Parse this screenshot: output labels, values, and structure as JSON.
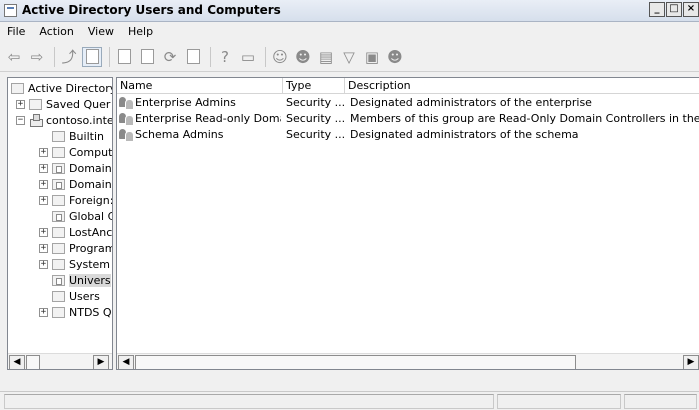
{
  "window": {
    "title": "Active Directory Users and Computers"
  },
  "window_buttons": {
    "minimize": "_",
    "maximize": "□",
    "close": "×"
  },
  "menu": [
    "File",
    "Action",
    "View",
    "Help"
  ],
  "toolbar": {
    "icons": [
      "back-icon",
      "forward-icon",
      "up-icon",
      "show-tree-icon",
      "properties-icon",
      "copy-icon",
      "refresh-icon",
      "export-icon",
      "help-icon",
      "console-icon",
      "add-user-icon",
      "add-group-icon",
      "add-ou-icon",
      "filter-icon",
      "find-icon",
      "add-to-group-icon"
    ]
  },
  "tree": {
    "root": "Active Directory",
    "items": [
      {
        "label": "Saved Quer",
        "expander": "+"
      },
      {
        "label": "contoso.inte",
        "expander": "−"
      },
      {
        "label": "Builtin",
        "expander": ""
      },
      {
        "label": "Comput",
        "expander": "+"
      },
      {
        "label": "Domain",
        "expander": "+"
      },
      {
        "label": "Domain",
        "expander": "+"
      },
      {
        "label": "Foreign:",
        "expander": "+"
      },
      {
        "label": "Global C",
        "expander": ""
      },
      {
        "label": "LostAnc",
        "expander": "+"
      },
      {
        "label": "Program",
        "expander": "+"
      },
      {
        "label": "System",
        "expander": "+"
      },
      {
        "label": "Univers",
        "expander": "",
        "selected": true
      },
      {
        "label": "Users",
        "expander": ""
      },
      {
        "label": "NTDS Q",
        "expander": "+"
      }
    ]
  },
  "list": {
    "columns": [
      "Name",
      "Type",
      "Description"
    ],
    "rows": [
      {
        "name": "Enterprise Admins",
        "type": "Security ...",
        "description": "Designated administrators of the enterprise"
      },
      {
        "name": "Enterprise Read-only Domai...",
        "type": "Security ...",
        "description": "Members of this group are Read-Only Domain Controllers in the enterprise"
      },
      {
        "name": "Schema Admins",
        "type": "Security ...",
        "description": "Designated administrators of the schema"
      }
    ]
  },
  "scroll": {
    "left": "◀",
    "right": "▶"
  }
}
